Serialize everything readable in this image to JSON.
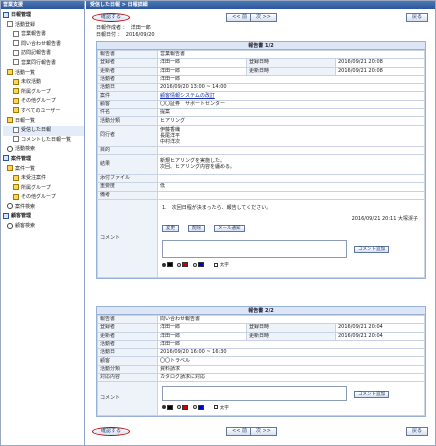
{
  "sidebar": {
    "title": "営業支援",
    "items": [
      {
        "label": "日報管理",
        "level": 0,
        "icon": "book"
      },
      {
        "label": "活動登録",
        "level": 1,
        "icon": "doc"
      },
      {
        "label": "営業報告書",
        "level": 2,
        "icon": "doc"
      },
      {
        "label": "問い合わせ報告書",
        "level": 2,
        "icon": "doc"
      },
      {
        "label": "訪問記報告書",
        "level": 2,
        "icon": "doc"
      },
      {
        "label": "営業同行報告書",
        "level": 2,
        "icon": "doc"
      },
      {
        "label": "活動一覧",
        "level": 1,
        "icon": "folder"
      },
      {
        "label": "未収活動",
        "level": 2,
        "icon": "folder"
      },
      {
        "label": "所属グループ",
        "level": 2,
        "icon": "folder"
      },
      {
        "label": "その他グループ",
        "level": 2,
        "icon": "folder"
      },
      {
        "label": "すべてのユーザー",
        "level": 2,
        "icon": "folder"
      },
      {
        "label": "日報一覧",
        "level": 1,
        "icon": "folder"
      },
      {
        "label": "受信した日報",
        "level": 2,
        "icon": "doc",
        "selected": true
      },
      {
        "label": "コメントした日報一覧",
        "level": 2,
        "icon": "doc"
      },
      {
        "label": "活動検索",
        "level": 1,
        "icon": "lens"
      },
      {
        "label": "案件管理",
        "level": 0,
        "icon": "book"
      },
      {
        "label": "案件一覧",
        "level": 1,
        "icon": "folder"
      },
      {
        "label": "未受注案件",
        "level": 2,
        "icon": "folder"
      },
      {
        "label": "所属グループ",
        "level": 2,
        "icon": "folder"
      },
      {
        "label": "その他グループ",
        "level": 2,
        "icon": "folder"
      },
      {
        "label": "案件検索",
        "level": 1,
        "icon": "lens"
      },
      {
        "label": "顧客管理",
        "level": 0,
        "icon": "book"
      },
      {
        "label": "顧客検索",
        "level": 1,
        "icon": "lens"
      }
    ]
  },
  "header": {
    "breadcrumb": "受信した日報 > 日報詳細"
  },
  "toolbar": {
    "confirm_label": "確認する",
    "prev_label": "<< 前",
    "next_label": "次 >>",
    "back_label": "戻る"
  },
  "meta": {
    "author_label": "日報作成者",
    "author_value": "洋田一郎",
    "date_label": "日報日付",
    "date_value": "2016/09/20"
  },
  "report1": {
    "title": "報告書 1/2",
    "rows": [
      {
        "k": "報告書",
        "v": "営業報告書"
      },
      {
        "k": "登録者",
        "v": "洋田一郎",
        "k2": "登録日時",
        "v2": "2016/09/21 20:08"
      },
      {
        "k": "更新者",
        "v": "洋田一郎",
        "k2": "更新日時",
        "v2": "2016/09/21 20:08"
      },
      {
        "k": "活動者",
        "v": "洋田一郎"
      },
      {
        "k": "活動日",
        "v": "2016/09/20 13:00 ~ 14:00"
      },
      {
        "k": "案件",
        "v": "顧客情報システムの改訂",
        "link": true
      },
      {
        "k": "顧客",
        "v": "〇〇証券　サポートセンター"
      },
      {
        "k": "件名",
        "v": "提案"
      },
      {
        "k": "活動分類",
        "v": "ヒアリング"
      }
    ],
    "companions_label": "同行者",
    "companions": [
      "伊藤香織",
      "長尾洋平",
      "中村洋次"
    ],
    "purpose_label": "目的",
    "result_label": "結果",
    "result_text": [
      "新規ヒアリングを実施した。",
      "次回、ヒアリング内容を纏める。"
    ],
    "attach_label": "添付ファイル",
    "importance_label": "重要度",
    "importance_value": "低",
    "remarks_label": "備考",
    "comment_label": "コメント",
    "comment_text": "1.　次回日程が決まったら、報告してください。",
    "comment_meta": "2016/09/21 20:11 大塚渓子",
    "edit_label": "変更",
    "delete_label": "削除",
    "mail_label": "メール通知",
    "add_comment_label": "コメント追加",
    "bold_label": "太字"
  },
  "report2": {
    "title": "報告書 2/2",
    "rows": [
      {
        "k": "報告書",
        "v": "問い合わせ報告書"
      },
      {
        "k": "登録者",
        "v": "洋田一郎",
        "k2": "登録日時",
        "v2": "2016/09/21 20:04"
      },
      {
        "k": "更新者",
        "v": "洋田一郎",
        "k2": "更新日時",
        "v2": "2016/09/21 20:04"
      },
      {
        "k": "活動者",
        "v": "洋田一郎"
      },
      {
        "k": "活動日",
        "v": "2016/09/20 16:00 ~ 16:30"
      },
      {
        "k": "顧客",
        "v": "〇〇トラベル"
      },
      {
        "k": "活動分類",
        "v": "資料請求"
      },
      {
        "k": "対応内容",
        "v": "カタログ請求に対応"
      }
    ],
    "comment_label": "コメント",
    "add_comment_label": "コメント追加",
    "bold_label": "太字"
  },
  "colors": {
    "black": "#000000",
    "red": "#cc0000",
    "blue": "#0000cc"
  }
}
